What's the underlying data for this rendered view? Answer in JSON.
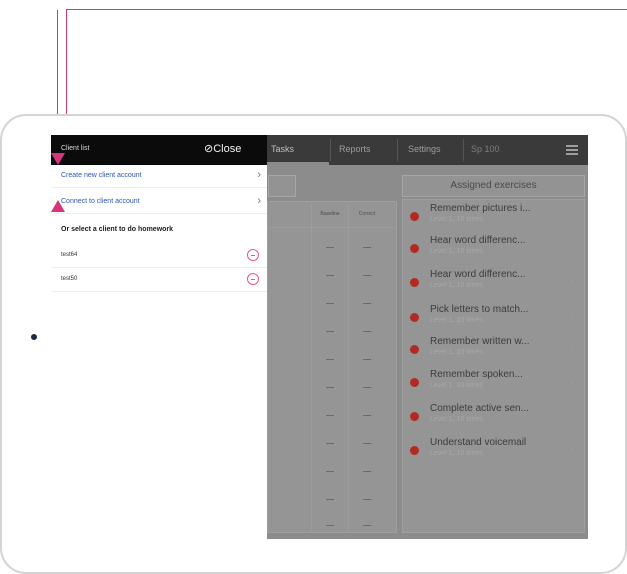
{
  "topbar": {
    "tasks": "Tasks",
    "reports": "Reports",
    "settings": "Settings",
    "search": "Sp 100"
  },
  "overlay": {
    "title": "Client list",
    "close": "⊘Close",
    "create_account": "Create new client account",
    "connect_account": "Connect to client account",
    "section_label": "Or select a client to do homework",
    "clients": [
      {
        "name": "test64"
      },
      {
        "name": "test50"
      }
    ]
  },
  "table": {
    "col_baseline": "Baseline",
    "col_correct": "Correct"
  },
  "assigned": {
    "header": "Assigned exercises",
    "items": [
      {
        "title": "Remember pictures i...",
        "subtitle": "Level 1, 10 times"
      },
      {
        "title": "Hear word differenc...",
        "subtitle": "Level 1, 10 times"
      },
      {
        "title": "Hear word differenc...",
        "subtitle": "Level 1, 10 times"
      },
      {
        "title": "Pick letters to match...",
        "subtitle": "Level 1, 10 times"
      },
      {
        "title": "Remember written w...",
        "subtitle": "Level 1, 10 times"
      },
      {
        "title": "Remember spoken...",
        "subtitle": "Level 1, 10 times"
      },
      {
        "title": "Complete active sen...",
        "subtitle": "Level 1, 10 times"
      },
      {
        "title": "Understand voicemail",
        "subtitle": "Level 1, 10 times"
      }
    ]
  },
  "colors": {
    "annotation": "#d6357a",
    "link": "#2c57b3",
    "exercise_dot": "#b22a22"
  }
}
